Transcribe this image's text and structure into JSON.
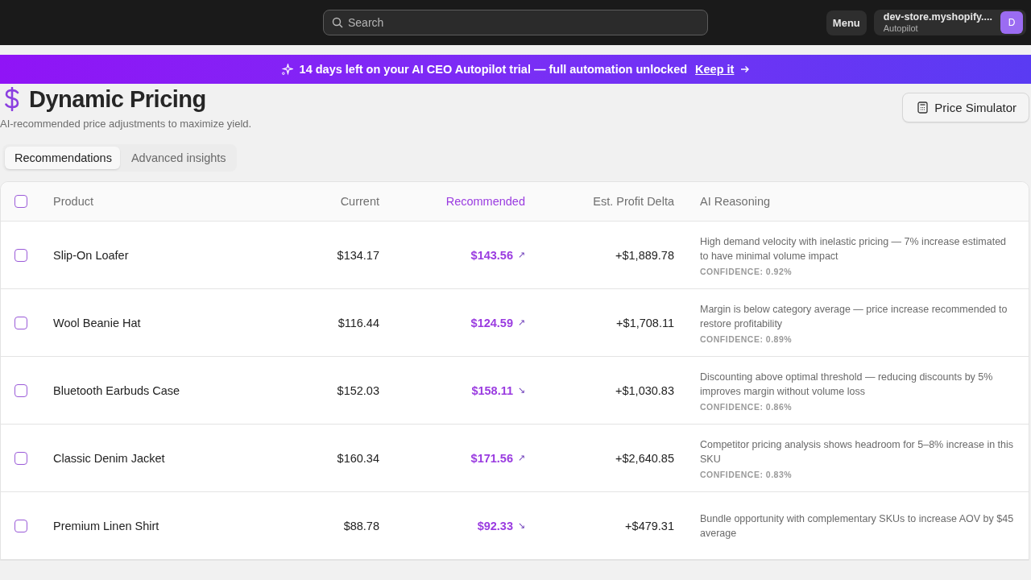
{
  "top_bar": {
    "search": {
      "placeholder": "Search"
    },
    "menu_button": "Menu",
    "store": {
      "name": "dev-store.myshopify....",
      "plan": "Autopilot",
      "avatar": "D"
    }
  },
  "banner": {
    "message": "14 days left on your AI CEO Autopilot trial — full automation unlocked",
    "link": "Keep it"
  },
  "header": {
    "title": "Dynamic Pricing",
    "subtitle": "AI-recommended price adjustments to maximize yield.",
    "action": "Price Simulator"
  },
  "tabs": [
    {
      "label": "Recommendations",
      "selected": true
    },
    {
      "label": "Advanced insights",
      "selected": false
    }
  ],
  "table": {
    "select_all_checked": false,
    "columns": [
      "Product",
      "Current",
      "Recommended",
      "Est. Profit Delta",
      "AI Reasoning"
    ],
    "rows": [
      {
        "checked": false,
        "product": "Slip-On Loafer",
        "current": "$134.17",
        "recommended": "$143.56",
        "arrow": "↗",
        "delta": "+$1,889.78",
        "reasoning": "High demand velocity with inelastic pricing — 7% increase estimated to have minimal volume impact",
        "confidence": "CONFIDENCE: 0.92%"
      },
      {
        "checked": false,
        "product": "Wool Beanie Hat",
        "current": "$116.44",
        "recommended": "$124.59",
        "arrow": "↗",
        "delta": "+$1,708.11",
        "reasoning": "Margin is below category average — price increase recommended to restore profitability",
        "confidence": "CONFIDENCE: 0.89%"
      },
      {
        "checked": false,
        "product": "Bluetooth Earbuds Case",
        "current": "$152.03",
        "recommended": "$158.11",
        "arrow": "↘",
        "delta": "+$1,030.83",
        "reasoning": "Discounting above optimal threshold — reducing discounts by 5% improves margin without volume loss",
        "confidence": "CONFIDENCE: 0.86%"
      },
      {
        "checked": false,
        "product": "Classic Denim Jacket",
        "current": "$160.34",
        "recommended": "$171.56",
        "arrow": "↗",
        "delta": "+$2,640.85",
        "reasoning": "Competitor pricing analysis shows headroom for 5–8% increase in this SKU",
        "confidence": "CONFIDENCE: 0.83%"
      },
      {
        "checked": false,
        "product": "Premium Linen Shirt",
        "current": "$88.78",
        "recommended": "$92.33",
        "arrow": "↘",
        "delta": "+$479.31",
        "reasoning": "Bundle opportunity with complementary SKUs to increase AOV by $45 average"
      }
    ]
  }
}
